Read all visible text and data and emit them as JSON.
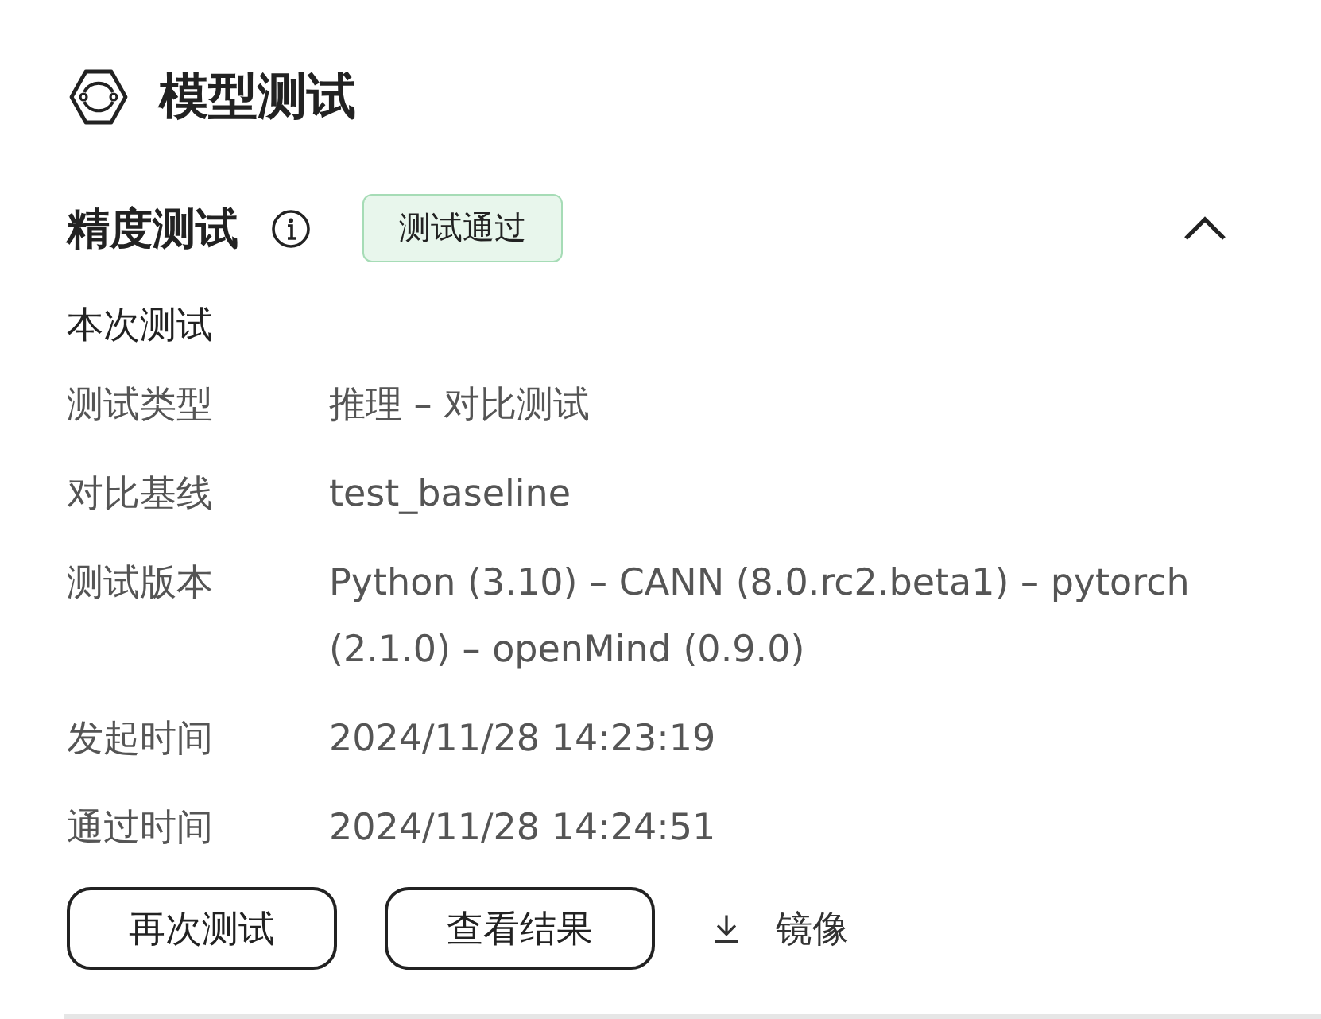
{
  "header": {
    "title": "模型测试"
  },
  "section": {
    "title": "精度测试",
    "status": "测试通过",
    "expanded": true,
    "subheading": "本次测试",
    "rows": [
      {
        "label": "测试类型",
        "value": "推理 – 对比测试"
      },
      {
        "label": "对比基线",
        "value": "test_baseline"
      },
      {
        "label": "测试版本",
        "value": "Python (3.10) – CANN (8.0.rc2.beta1) – pytorch (2.1.0) – openMind (0.9.0)"
      },
      {
        "label": "发起时间",
        "value": "2024/11/28 14:23:19"
      },
      {
        "label": "通过时间",
        "value": "2024/11/28 14:24:51"
      }
    ],
    "buttons": [
      "再次测试",
      "查看结果"
    ],
    "download": {
      "label": "镜像"
    }
  }
}
